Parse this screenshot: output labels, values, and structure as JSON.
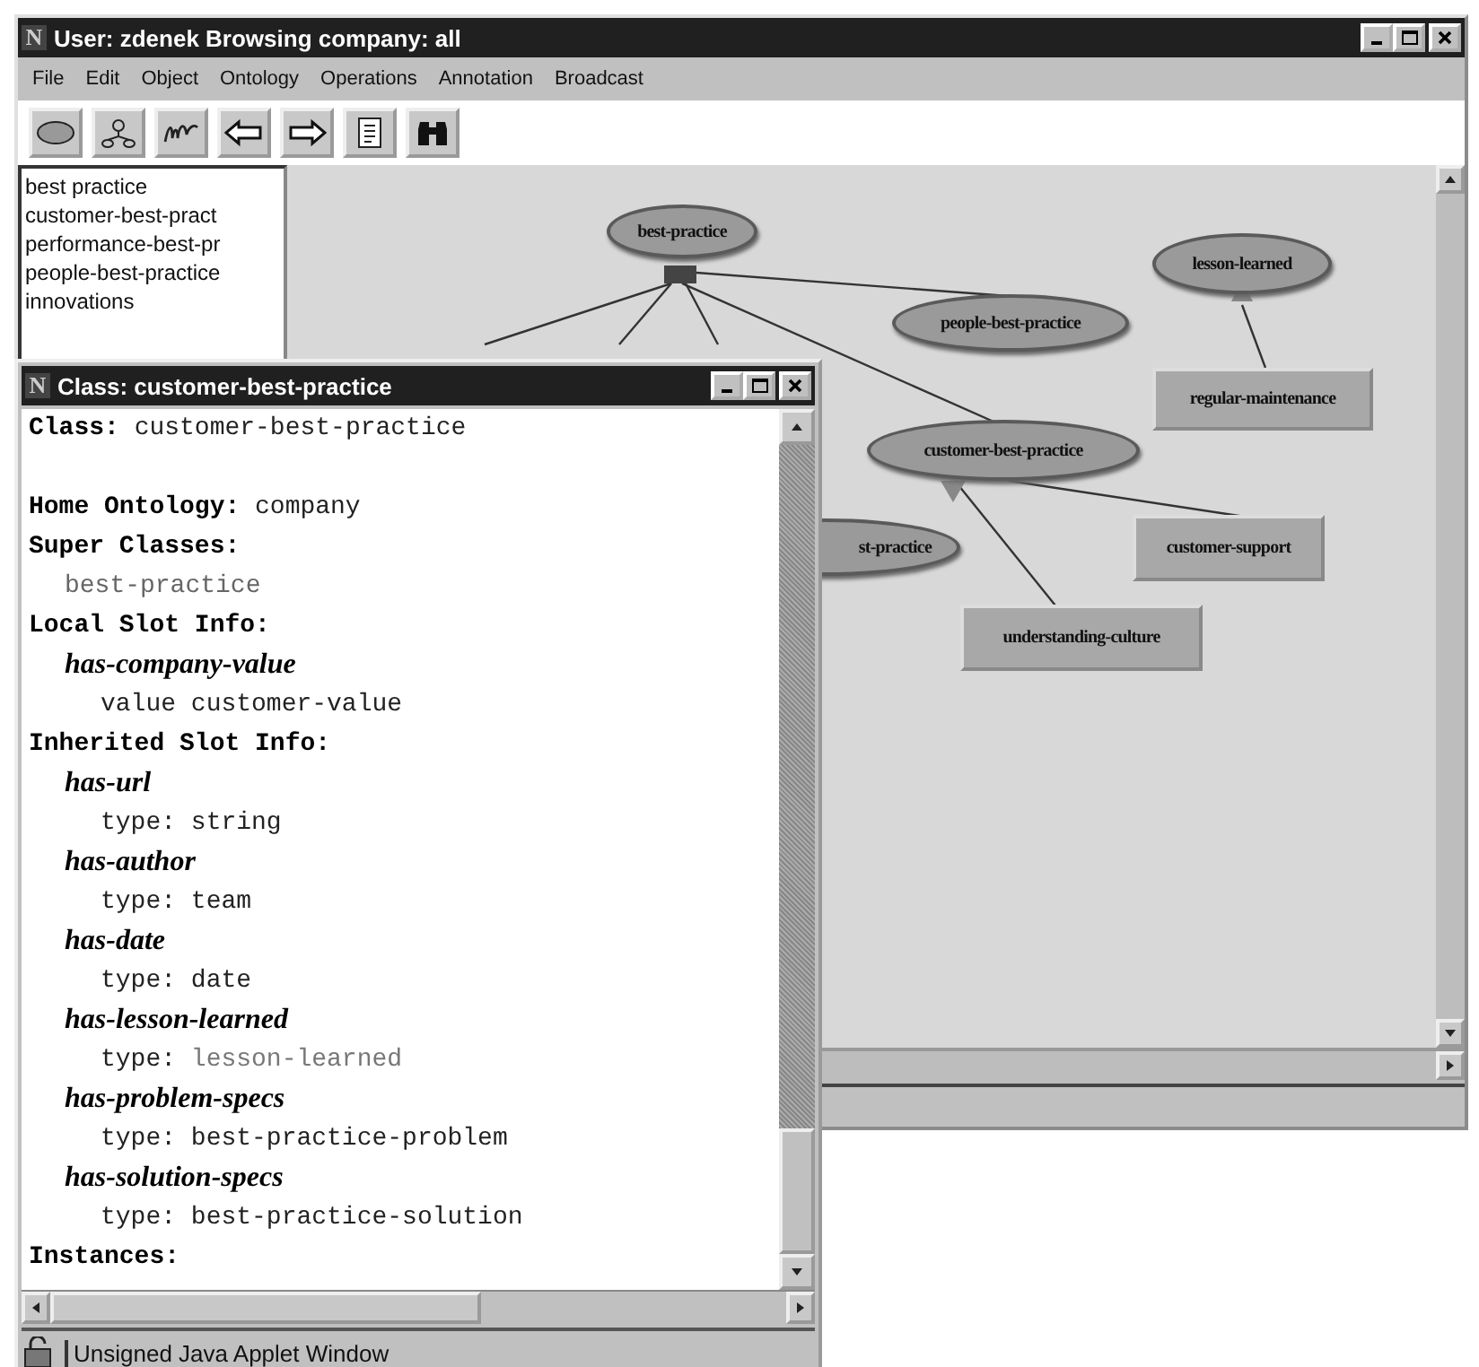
{
  "window": {
    "app_icon": "N",
    "title": "User: zdenek Browsing company: all"
  },
  "menu": [
    "File",
    "Edit",
    "Object",
    "Ontology",
    "Operations",
    "Annotation",
    "Broadcast"
  ],
  "toolbar": [
    {
      "kind": "ellipse"
    },
    {
      "kind": "hierarchy"
    },
    {
      "kind": "scribble"
    },
    {
      "kind": "back"
    },
    {
      "kind": "forward"
    },
    {
      "kind": "document"
    },
    {
      "kind": "binoculars"
    }
  ],
  "class_list": [
    "best practice",
    "customer-best-pract",
    "performance-best-pr",
    "people-best-practice",
    "innovations"
  ],
  "graph": {
    "nodes": [
      {
        "label": "best-practice",
        "kind": "class"
      },
      {
        "label": "lesson-learned",
        "kind": "class"
      },
      {
        "label": "people-best-practice",
        "kind": "class"
      },
      {
        "label": "regular-maintenance",
        "kind": "instance"
      },
      {
        "label": "customer-best-practice",
        "kind": "class"
      },
      {
        "label": "st-practice",
        "kind": "class"
      },
      {
        "label": "customer-support",
        "kind": "instance"
      },
      {
        "label": "understanding-culture",
        "kind": "instance"
      }
    ]
  },
  "class_window": {
    "app_icon": "N",
    "title": "Class: customer-best-practice",
    "lines": [
      {
        "kind": "heading",
        "text": "**Class:** customer-best-practice"
      },
      {
        "kind": "blank"
      },
      {
        "kind": "heading",
        "text": "**Home Ontology:** company"
      },
      {
        "kind": "heading",
        "text": "**Super Classes:**"
      },
      {
        "kind": "link",
        "text": "best-practice"
      },
      {
        "kind": "heading",
        "text": "**Local Slot Info:**"
      },
      {
        "kind": "slot",
        "text": "has-company-value"
      },
      {
        "kind": "detail",
        "label": "value",
        "value": "customer-value",
        "linked": false
      },
      {
        "kind": "heading",
        "text": "**Inherited Slot Info:**"
      },
      {
        "kind": "slot",
        "text": "has-url"
      },
      {
        "kind": "detail",
        "label": "type:",
        "value": "string",
        "linked": false
      },
      {
        "kind": "slot",
        "text": "has-author"
      },
      {
        "kind": "detail",
        "label": "type:",
        "value": "team",
        "linked": false
      },
      {
        "kind": "slot",
        "text": "has-date"
      },
      {
        "kind": "detail",
        "label": "type:",
        "value": "date",
        "linked": false
      },
      {
        "kind": "slot",
        "text": "has-lesson-learned"
      },
      {
        "kind": "detail",
        "label": "type:",
        "value": "lesson-learned",
        "linked": true
      },
      {
        "kind": "slot",
        "text": "has-problem-specs"
      },
      {
        "kind": "detail",
        "label": "type:",
        "value": "best-practice-problem",
        "linked": false
      },
      {
        "kind": "slot",
        "text": "has-solution-specs"
      },
      {
        "kind": "detail",
        "label": "type:",
        "value": "best-practice-solution",
        "linked": false
      },
      {
        "kind": "heading",
        "text": "**Instances:**"
      }
    ],
    "status": "Unsigned Java Applet Window"
  }
}
